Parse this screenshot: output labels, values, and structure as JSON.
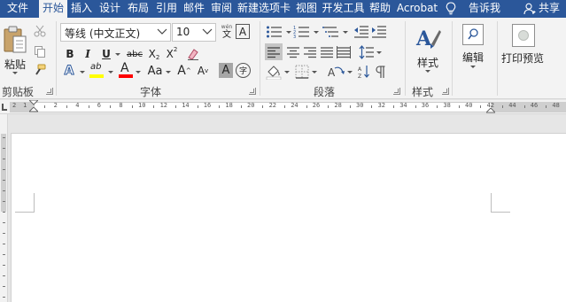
{
  "tabs": [
    {
      "label": "文件",
      "active": false
    },
    {
      "label": "开始",
      "active": true
    },
    {
      "label": "插入",
      "active": false
    },
    {
      "label": "设计",
      "active": false
    },
    {
      "label": "布局",
      "active": false
    },
    {
      "label": "引用",
      "active": false
    },
    {
      "label": "邮件",
      "active": false
    },
    {
      "label": "审阅",
      "active": false
    },
    {
      "label": "新建选项卡",
      "active": false
    },
    {
      "label": "视图",
      "active": false
    },
    {
      "label": "开发工具",
      "active": false
    },
    {
      "label": "帮助",
      "active": false
    },
    {
      "label": "Acrobat",
      "active": false
    }
  ],
  "tell_me": "告诉我",
  "share": "共享",
  "clipboard": {
    "paste_label": "粘贴",
    "group_label": "剪贴板"
  },
  "font": {
    "name": "等线 (中文正文)",
    "size": "10",
    "group_label": "字体",
    "phonetic_top": "wén",
    "phonetic_char": "文",
    "border_char": "A",
    "bold": "B",
    "italic": "I",
    "underline": "U",
    "strike": "abc",
    "subscript": "X",
    "superscript": "X",
    "subscript_mark": "2",
    "superscript_mark": "2",
    "effects": "A",
    "highlight": "ab",
    "font_color": "A",
    "change_case": "Aa",
    "grow": "A",
    "shrink": "A",
    "char_shading": "A",
    "enclose": "字"
  },
  "paragraph": {
    "group_label": "段落"
  },
  "styles": {
    "label": "样式",
    "group_label": "样式"
  },
  "editing": {
    "label": "编辑"
  },
  "print_preview": {
    "label": "打印预览"
  },
  "ruler": {
    "left_numbers": [
      "2",
      "1"
    ],
    "numbers": [
      "2",
      "4",
      "6",
      "8",
      "10",
      "12",
      "14",
      "16",
      "18",
      "20",
      "22",
      "24",
      "26",
      "28",
      "30",
      "32",
      "34",
      "36",
      "38",
      "40",
      "42",
      "44",
      "46",
      "48"
    ]
  },
  "colors": {
    "accent": "#2b579a",
    "highlight_bar": "#ffff00",
    "font_color_bar": "#ff0000"
  }
}
